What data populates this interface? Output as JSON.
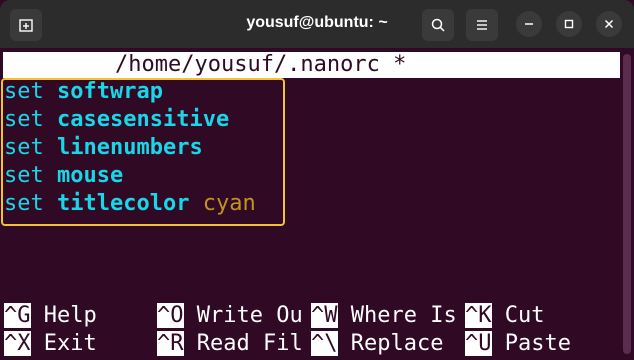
{
  "window": {
    "title": "yousuf@ubuntu: ~"
  },
  "nano": {
    "header": "/home/yousuf/.nanorc *",
    "lines": [
      {
        "keyword": "set",
        "option": "softwrap",
        "value": ""
      },
      {
        "keyword": "set",
        "option": "casesensitive",
        "value": ""
      },
      {
        "keyword": "set",
        "option": "linenumbers",
        "value": ""
      },
      {
        "keyword": "set",
        "option": "mouse",
        "value": ""
      },
      {
        "keyword": "set",
        "option": "titlecolor",
        "value": "cyan"
      }
    ],
    "shortcuts_row1": [
      {
        "key": "^G",
        "label": "Help"
      },
      {
        "key": "^O",
        "label": "Write Ou"
      },
      {
        "key": "^W",
        "label": "Where Is"
      },
      {
        "key": "^K",
        "label": "Cut"
      }
    ],
    "shortcuts_row2": [
      {
        "key": "^X",
        "label": "Exit"
      },
      {
        "key": "^R",
        "label": "Read Fil"
      },
      {
        "key": "^\\",
        "label": "Replace"
      },
      {
        "key": "^U",
        "label": "Paste"
      }
    ]
  },
  "colors": {
    "background": "#300a24",
    "text_cyan": "#19d6e8",
    "text_value": "#c29224",
    "highlight_border": "#f2c233"
  },
  "icons": {
    "new_tab": "new-tab-icon",
    "search": "search-icon",
    "menu": "hamburger-menu-icon",
    "minimize": "minimize-icon",
    "maximize": "maximize-icon",
    "close": "close-icon"
  }
}
